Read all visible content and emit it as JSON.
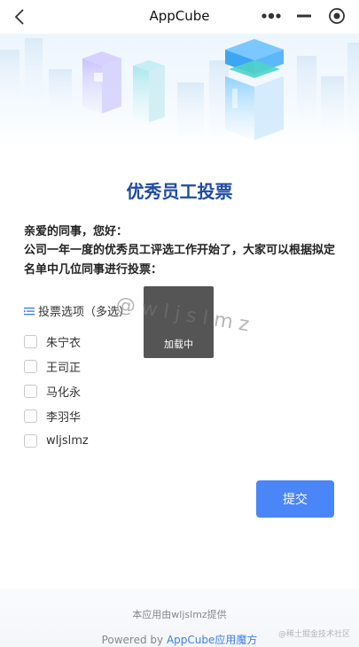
{
  "navbar": {
    "title": "AppCube",
    "back_icon": "chevron-left-icon",
    "more_icon": "more-dots-icon",
    "minimize_icon": "minimize-icon",
    "close_icon": "target-close-icon"
  },
  "main": {
    "title": "优秀员工投票",
    "greeting": "亲爱的同事，您好：",
    "intro": "公司一年一度的优秀员工评选工作开始了，大家可以根据拟定名单中几位同事进行投票：",
    "section_label": "投票选项（多选）",
    "section_icon": "list-icon",
    "options": [
      {
        "label": "朱宁衣",
        "checked": false
      },
      {
        "label": "王司正",
        "checked": false
      },
      {
        "label": "马化永",
        "checked": false
      },
      {
        "label": "李羽华",
        "checked": false
      },
      {
        "label": "wljslmz",
        "checked": false
      }
    ],
    "submit_label": "提交"
  },
  "toast": {
    "text": "加载中"
  },
  "watermark": {
    "text": "@wljslmz"
  },
  "footer": {
    "provider": "本应用由wljslmz提供",
    "powered_prefix": "Powered by",
    "powered_link": "AppCube应用魔方",
    "corner_watermark": "@稀土掘金技术社区"
  },
  "colors": {
    "title": "#1f4ba3",
    "submit": "#4a86f8",
    "link": "#3f7ee8"
  }
}
